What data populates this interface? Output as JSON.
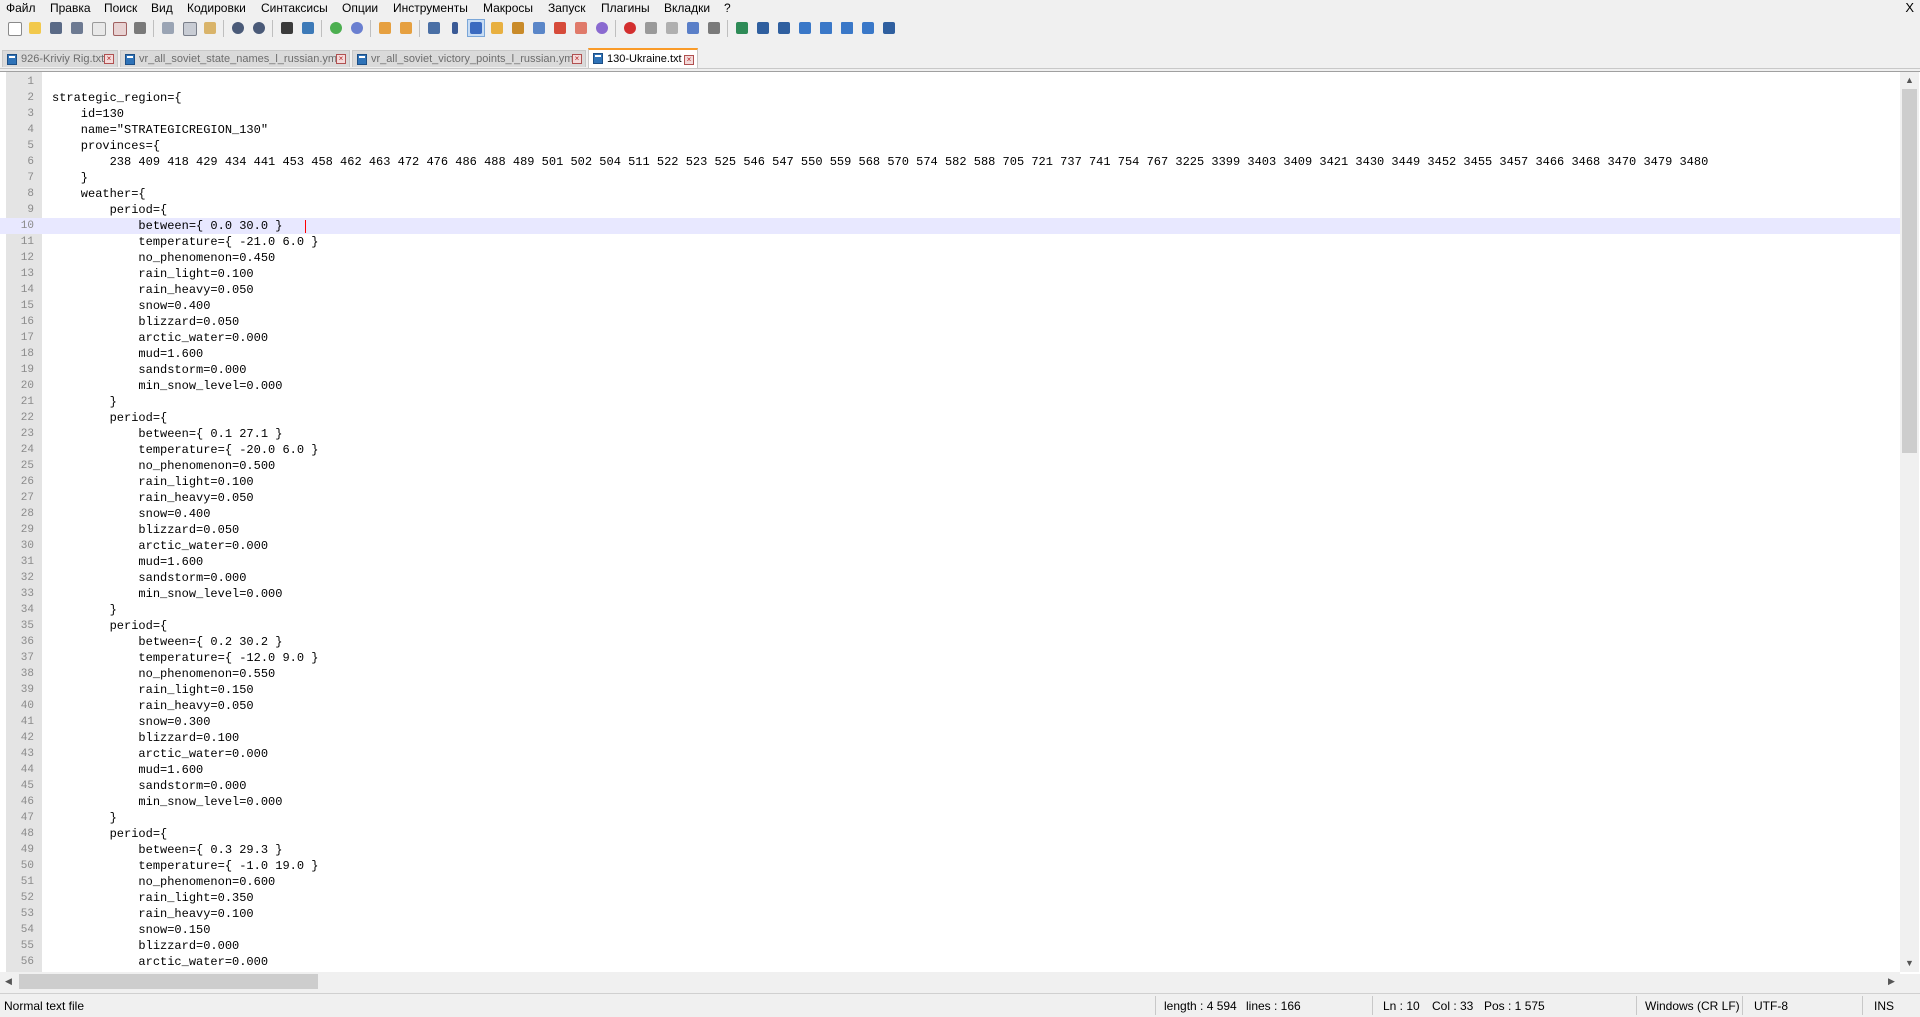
{
  "menu": [
    "Файл",
    "Правка",
    "Поиск",
    "Вид",
    "Кодировки",
    "Синтаксисы",
    "Опции",
    "Инструменты",
    "Макросы",
    "Запуск",
    "Плагины",
    "Вкладки",
    "?"
  ],
  "window_close_glyph": "X",
  "toolbar": {
    "icons": [
      "new-file-icon",
      "open-file-icon",
      "save-icon",
      "save-all-icon",
      "close-icon",
      "close-all-icon",
      "print-icon",
      "cut-icon",
      "copy-icon",
      "paste-icon",
      "undo-icon",
      "redo-icon",
      "find-icon",
      "replace-icon",
      "zoom-in-icon",
      "zoom-out-icon",
      "sync-vertical-icon",
      "sync-horizontal-icon",
      "word-wrap-icon",
      "show-all-chars-icon",
      "indent-guide-icon",
      "user-language-icon",
      "document-map-icon",
      "function-list-icon",
      "folder-as-workspace-icon",
      "monitoring-icon",
      "record-macro-icon",
      "stop-record-icon",
      "play-macro-icon",
      "run-macro-multiple-icon",
      "save-macro-icon",
      "plugin-icon-1",
      "plugin-icon-2",
      "plugin-icon-3",
      "plugin-icon-4",
      "plugin-up-icon",
      "plugin-down-icon",
      "plugin-icon-5",
      "plugin-icon-6"
    ]
  },
  "tabs": [
    {
      "label": "926-Kriviy Rig.txt",
      "active": false
    },
    {
      "label": "vr_all_soviet_state_names_l_russian.yml",
      "active": false
    },
    {
      "label": "vr_all_soviet_victory_points_l_russian.yml",
      "active": false
    },
    {
      "label": "130-Ukraine.txt",
      "active": true
    }
  ],
  "editor": {
    "current_line": 10,
    "lines": [
      "",
      "strategic_region={",
      "    id=130",
      "    name=\"STRATEGICREGION_130\"",
      "    provinces={",
      "        238 409 418 429 434 441 453 458 462 463 472 476 486 488 489 501 502 504 511 522 523 525 546 547 550 559 568 570 574 582 588 705 721 737 741 754 767 3225 3399 3403 3409 3421 3430 3449 3452 3455 3457 3466 3468 3470 3479 3480",
      "    }",
      "    weather={",
      "        period={",
      "            between={ 0.0 30.0 }",
      "            temperature={ -21.0 6.0 }",
      "            no_phenomenon=0.450",
      "            rain_light=0.100",
      "            rain_heavy=0.050",
      "            snow=0.400",
      "            blizzard=0.050",
      "            arctic_water=0.000",
      "            mud=1.600",
      "            sandstorm=0.000",
      "            min_snow_level=0.000",
      "        }",
      "        period={",
      "            between={ 0.1 27.1 }",
      "            temperature={ -20.0 6.0 }",
      "            no_phenomenon=0.500",
      "            rain_light=0.100",
      "            rain_heavy=0.050",
      "            snow=0.400",
      "            blizzard=0.050",
      "            arctic_water=0.000",
      "            mud=1.600",
      "            sandstorm=0.000",
      "            min_snow_level=0.000",
      "        }",
      "        period={",
      "            between={ 0.2 30.2 }",
      "            temperature={ -12.0 9.0 }",
      "            no_phenomenon=0.550",
      "            rain_light=0.150",
      "            rain_heavy=0.050",
      "            snow=0.300",
      "            blizzard=0.100",
      "            arctic_water=0.000",
      "            mud=1.600",
      "            sandstorm=0.000",
      "            min_snow_level=0.000",
      "        }",
      "        period={",
      "            between={ 0.3 29.3 }",
      "            temperature={ -1.0 19.0 }",
      "            no_phenomenon=0.600",
      "            rain_light=0.350",
      "            rain_heavy=0.100",
      "            snow=0.150",
      "            blizzard=0.000",
      "            arctic_water=0.000"
    ]
  },
  "status": {
    "file_type": "Normal text file",
    "length": "length : 4 594",
    "lines": "lines : 166",
    "ln": "Ln : 10",
    "col": "Col : 33",
    "pos": "Pos : 1 575",
    "eol": "Windows (CR LF)",
    "encoding": "UTF-8",
    "mode": "INS"
  },
  "colors": {
    "active_tab_accent": "#fa9b28",
    "current_line_bg": "#e8e8ff",
    "caret": "#ff0000"
  }
}
